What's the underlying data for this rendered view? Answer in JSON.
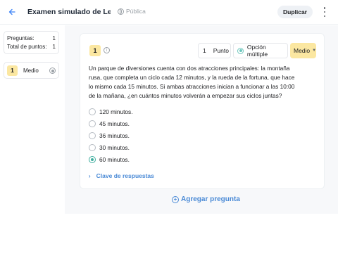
{
  "header": {
    "back_icon": "arrow-left-icon",
    "title": "Examen simulado de Lengu...",
    "visibility": "Pública",
    "duplicate_label": "Duplicar",
    "more_icon": "kebab-menu-icon"
  },
  "sidebar": {
    "stats": [
      {
        "label": "Preguntas:",
        "value": "1"
      },
      {
        "label": "Total de puntos:",
        "value": "1"
      }
    ],
    "questions": [
      {
        "number": "1",
        "difficulty": "Medio"
      }
    ]
  },
  "question": {
    "number": "1",
    "points_value": "1",
    "points_unit": "Punto",
    "type": "Opción múltiple",
    "difficulty": "Medio",
    "text": "Un parque de diversiones cuenta con dos atracciones principales: la montaña rusa, que completa un ciclo cada 12 minutos, y la rueda de la fortuna, que hace lo mismo cada 15 minutos. Si ambas atracciones inician a funcionar a las 10:00 de la mañana, ¿en cuántos minutos volverán a empezar sus ciclos juntas?",
    "options": [
      {
        "label": "120 minutos.",
        "selected": false
      },
      {
        "label": "45 minutos.",
        "selected": false
      },
      {
        "label": "36 minutos.",
        "selected": false
      },
      {
        "label": "30 minutos.",
        "selected": false
      },
      {
        "label": "60 minutos.",
        "selected": true
      }
    ],
    "answer_key_label": "Clave de respuestas"
  },
  "add_question_label": "Agregar pregunta",
  "colors": {
    "accent": "#4a8ad6",
    "difficulty_badge": "#fbe7a1",
    "selected_option": "#3fae9f"
  }
}
